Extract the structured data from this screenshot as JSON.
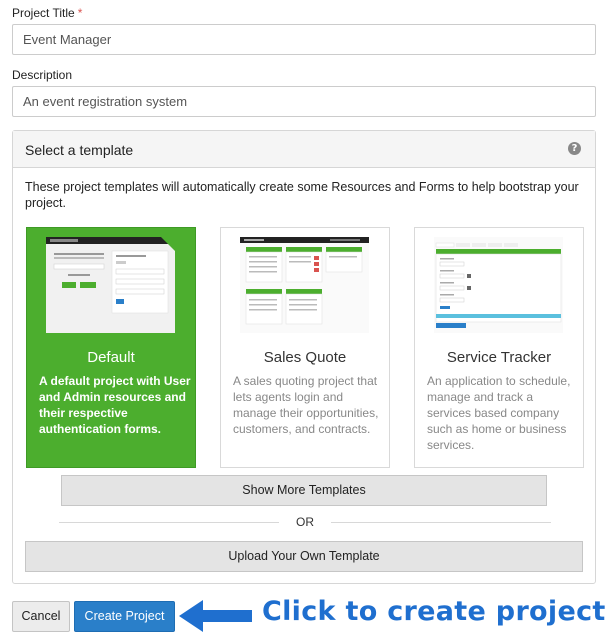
{
  "form": {
    "title_label": "Project Title",
    "required_mark": "*",
    "title_value": "Event Manager",
    "description_label": "Description",
    "description_value": "An event registration system"
  },
  "template_panel": {
    "title": "Select a template",
    "help_icon": "question-circle-icon",
    "intro": "These project templates will automatically create some Resources and Forms to help bootstrap your project."
  },
  "templates": [
    {
      "name": "Default",
      "description": "A default project with User and Admin resources and their respective authentication forms.",
      "selected": true
    },
    {
      "name": "Sales Quote",
      "description": "A sales quoting project that lets agents login and manage their opportunities, customers, and contracts.",
      "selected": false
    },
    {
      "name": "Service Tracker",
      "description": "An application to schedule, manage and track a services based company such as home or business services.",
      "selected": false
    }
  ],
  "actions": {
    "show_more": "Show More Templates",
    "or": "OR",
    "upload": "Upload Your Own Template",
    "cancel": "Cancel",
    "create": "Create Project"
  },
  "annotation": {
    "callout": "Click to create project."
  },
  "colors": {
    "selected_card": "#4cae2e",
    "primary_button": "#2a7fc9",
    "callout_text": "#1f6fcf",
    "required": "#d9534f"
  }
}
